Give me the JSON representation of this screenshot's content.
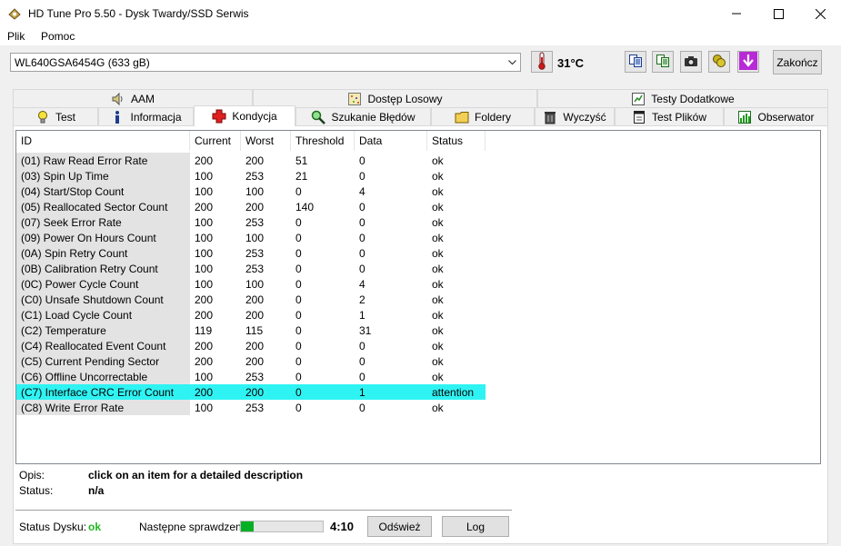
{
  "window": {
    "title": "HD Tune Pro 5.50 - Dysk Twardy/SSD Serwis"
  },
  "menu": {
    "file": "Plik",
    "help": "Pomoc"
  },
  "toolbar": {
    "drive": "WL640GSA6454G (633 gB)",
    "temperature": "31°C",
    "exit_label": "Zakończ"
  },
  "tabs_top": [
    {
      "label": "AAM",
      "icon": "speaker-icon"
    },
    {
      "label": "Dostęp Losowy",
      "icon": "random-access-icon"
    },
    {
      "label": "Testy Dodatkowe",
      "icon": "extra-tests-icon"
    }
  ],
  "tabs_bottom": [
    {
      "label": "Test",
      "icon": "lightbulb-icon"
    },
    {
      "label": "Informacja",
      "icon": "info-icon"
    },
    {
      "label": "Kondycja",
      "icon": "health-cross-icon",
      "active": true
    },
    {
      "label": "Szukanie Błędów",
      "icon": "magnifier-icon"
    },
    {
      "label": "Foldery",
      "icon": "folder-icon"
    },
    {
      "label": "Wyczyść",
      "icon": "trash-icon"
    },
    {
      "label": "Test Plików",
      "icon": "file-test-icon"
    },
    {
      "label": "Obserwator",
      "icon": "chart-icon"
    }
  ],
  "table": {
    "headers": [
      "ID",
      "Current",
      "Worst",
      "Threshold",
      "Data",
      "Status"
    ],
    "rows": [
      [
        "(01) Raw Read Error Rate",
        "200",
        "200",
        "51",
        "0",
        "ok"
      ],
      [
        "(03) Spin Up Time",
        "100",
        "253",
        "21",
        "0",
        "ok"
      ],
      [
        "(04) Start/Stop Count",
        "100",
        "100",
        "0",
        "4",
        "ok"
      ],
      [
        "(05) Reallocated Sector Count",
        "200",
        "200",
        "140",
        "0",
        "ok"
      ],
      [
        "(07) Seek Error Rate",
        "100",
        "253",
        "0",
        "0",
        "ok"
      ],
      [
        "(09) Power On Hours Count",
        "100",
        "100",
        "0",
        "0",
        "ok"
      ],
      [
        "(0A) Spin Retry Count",
        "100",
        "253",
        "0",
        "0",
        "ok"
      ],
      [
        "(0B) Calibration Retry Count",
        "100",
        "253",
        "0",
        "0",
        "ok"
      ],
      [
        "(0C) Power Cycle Count",
        "100",
        "100",
        "0",
        "4",
        "ok"
      ],
      [
        "(C0) Unsafe Shutdown Count",
        "200",
        "200",
        "0",
        "2",
        "ok"
      ],
      [
        "(C1) Load Cycle Count",
        "200",
        "200",
        "0",
        "1",
        "ok"
      ],
      [
        "(C2) Temperature",
        "119",
        "115",
        "0",
        "31",
        "ok"
      ],
      [
        "(C4) Reallocated Event Count",
        "200",
        "200",
        "0",
        "0",
        "ok"
      ],
      [
        "(C5) Current Pending Sector",
        "200",
        "200",
        "0",
        "0",
        "ok"
      ],
      [
        "(C6) Offline Uncorrectable",
        "100",
        "253",
        "0",
        "0",
        "ok"
      ],
      [
        "(C7) Interface CRC Error Count",
        "200",
        "200",
        "0",
        "1",
        "attention"
      ],
      [
        "(C8) Write Error Rate",
        "100",
        "253",
        "0",
        "0",
        "ok"
      ]
    ],
    "highlight_color": "#2ff3f3"
  },
  "details": {
    "description_label": "Opis:",
    "description_value": "click on an item for a detailed description",
    "status_label": "Status:",
    "status_value": "n/a"
  },
  "footer": {
    "disk_status_label": "Status Dysku:",
    "disk_status_value": "ok",
    "next_check_label": "Następne sprawdzenie:",
    "next_check_progress": 0.15,
    "next_check_time": "4:10",
    "refresh_label": "Odśwież",
    "log_label": "Log"
  },
  "colors": {
    "ok_green": "#23b723",
    "progress_green": "#06b025"
  }
}
